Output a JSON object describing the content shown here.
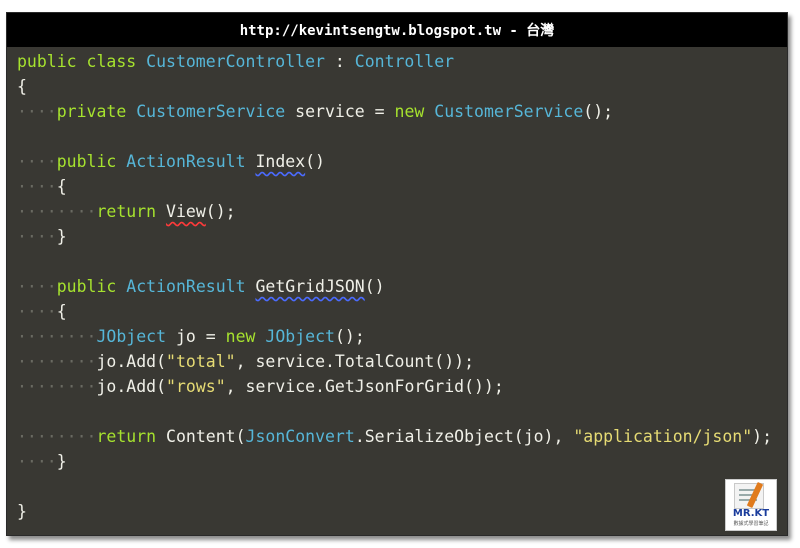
{
  "title": "http://kevintsengtw.blogspot.tw - 台灣",
  "indent_marker": "····",
  "logo": {
    "brand": "MR.KT",
    "sub": "數據式學習筆記"
  },
  "code": {
    "l1": {
      "a": "public class ",
      "b": "CustomerController",
      "c": " : ",
      "d": "Controller"
    },
    "l2": "{",
    "l3": {
      "a": "private ",
      "b": "CustomerService",
      "c": " service = ",
      "d": "new ",
      "e": "CustomerService",
      "f": "();"
    },
    "l5": {
      "a": "public ",
      "b": "ActionResult",
      "c": " ",
      "d": "Index",
      "e": "()"
    },
    "l6": "{",
    "l7": {
      "a": "return ",
      "b": "View",
      "c": "();"
    },
    "l8": "}",
    "l10": {
      "a": "public ",
      "b": "ActionResult",
      "c": " ",
      "d": "GetGridJSON",
      "e": "()"
    },
    "l11": "{",
    "l12": {
      "a": "JObject",
      "b": " jo = ",
      "c": "new ",
      "d": "JObject",
      "e": "();"
    },
    "l13": {
      "a": "jo.Add(",
      "b": "\"total\"",
      "c": ", service.TotalCount());"
    },
    "l14": {
      "a": "jo.Add(",
      "b": "\"rows\"",
      "c": ", service.GetJsonForGrid());"
    },
    "l16": {
      "a": "return ",
      "b": "Content(",
      "c": "JsonConvert",
      "d": ".SerializeObject(jo), ",
      "e": "\"application/json\"",
      "f": ");"
    },
    "l17": "}",
    "l19": "}"
  }
}
